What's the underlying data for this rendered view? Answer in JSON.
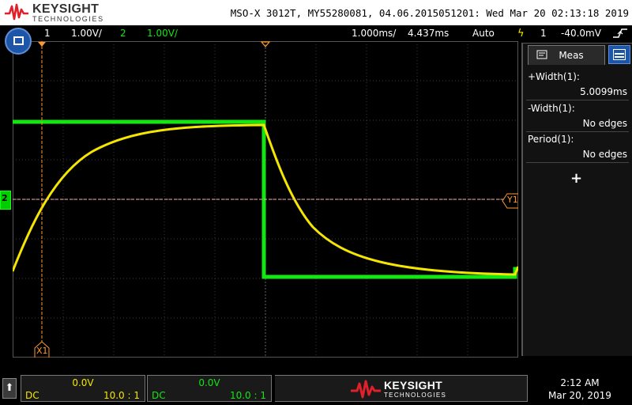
{
  "header": {
    "brand": "KEYSIGHT",
    "brand_sub": "TECHNOLOGIES",
    "title": "MSO-X 3012T, MY55280081, 04.06.2015051201: Wed Mar 20 02:13:18 2019"
  },
  "status": {
    "ch1_num": "1",
    "ch1_scale": "1.00V/",
    "ch2_num": "2",
    "ch2_scale": "1.00V/",
    "timebase": "1.000ms/",
    "delay": "4.437ms",
    "mode": "Auto",
    "trigger_source": "1",
    "trigger_level": "-40.0mV"
  },
  "screen": {
    "ch_marker_label": "2",
    "cursor_y_label": "Y1",
    "cursor_x_label": "X1"
  },
  "measurements": {
    "tab_label": "Meas",
    "items": [
      {
        "name": "+Width(1):",
        "value": "5.0099ms"
      },
      {
        "name": "-Width(1):",
        "value": "No edges"
      },
      {
        "name": "Period(1):",
        "value": "No edges"
      }
    ],
    "add_label": "+"
  },
  "channels": [
    {
      "offset": "0.0V",
      "coupling": "DC",
      "probe": "10.0 : 1",
      "color": "#f4e600"
    },
    {
      "offset": "0.0V",
      "coupling": "DC",
      "probe": "10.0 : 1",
      "color": "#14e614"
    }
  ],
  "footer": {
    "brand": "KEYSIGHT",
    "brand_sub": "TECHNOLOGIES",
    "time": "2:12 AM",
    "date": "Mar 20, 2019"
  },
  "colors": {
    "ch1": "#f4e600",
    "ch2": "#14e614",
    "accent": "#1d56a8",
    "trigger": "#ff9a2e",
    "brand_red": "#e0202a"
  }
}
